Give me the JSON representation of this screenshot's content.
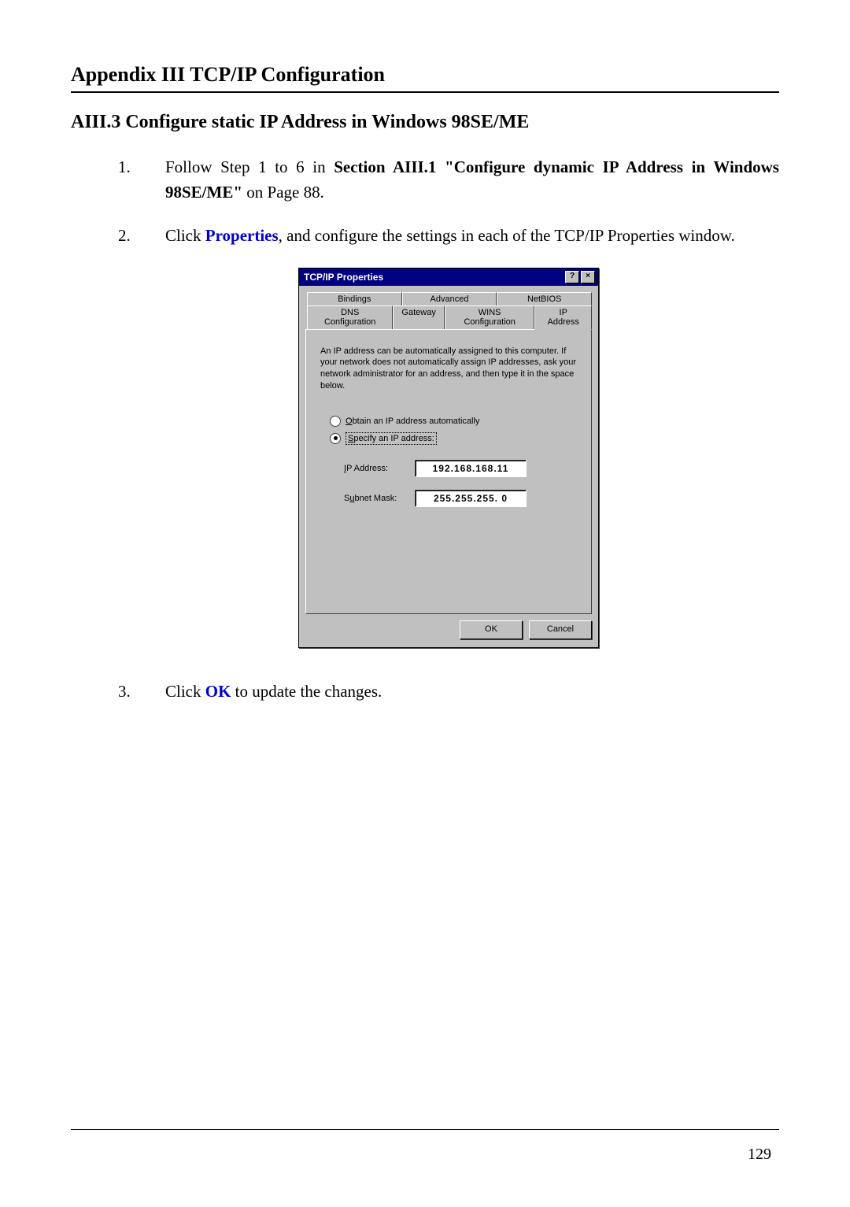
{
  "header": "Appendix III    TCP/IP Configuration",
  "section": "AIII.3 Configure static IP Address in Windows 98SE/ME",
  "steps": {
    "s1": {
      "num": "1.",
      "t1": "Follow Step 1 to 6 in ",
      "t2": "Section AIII.1 \"Configure dynamic IP Address in Windows 98SE/ME\"",
      "t3": " on Page 88."
    },
    "s2": {
      "num": "2.",
      "t1": "Click ",
      "t2": "Properties",
      "t3": ", and configure the settings in each of the TCP/IP Properties window."
    },
    "s3": {
      "num": "3.",
      "t1": "Click ",
      "t2": "OK",
      "t3": " to update the changes."
    }
  },
  "dialog": {
    "title": "TCP/IP Properties",
    "help_btn": "?",
    "close_btn": "×",
    "tabs_back": {
      "bindings": "Bindings",
      "advanced": "Advanced",
      "netbios": "NetBIOS"
    },
    "tabs_front": {
      "dns": "DNS Configuration",
      "gateway": "Gateway",
      "wins": "WINS Configuration",
      "ip": "IP Address"
    },
    "desc": "An IP address can be automatically assigned to this computer. If your network does not automatically assign IP addresses, ask your network administrator for an address, and then type it in the space below.",
    "radio_auto": {
      "ul": "O",
      "rest": "btain an IP address automatically"
    },
    "radio_specify": {
      "ul": "S",
      "rest": "pecify an IP address:"
    },
    "ip_label": {
      "ul": "I",
      "rest": "P Address:"
    },
    "ip_value": "192.168.168.11",
    "subnet_label": {
      "pre": "S",
      "ul": "u",
      "rest": "bnet Mask:"
    },
    "subnet_value": "255.255.255. 0",
    "ok": "OK",
    "cancel": "Cancel"
  },
  "page_number": "129"
}
